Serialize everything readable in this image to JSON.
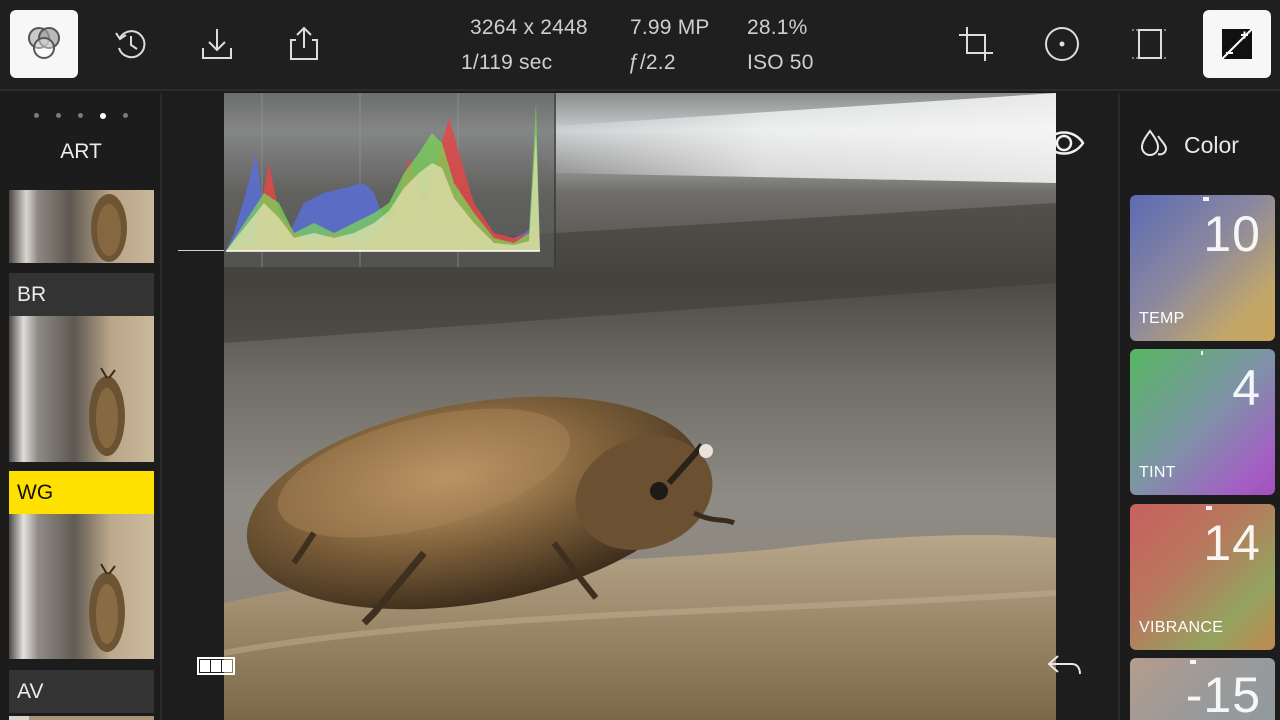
{
  "toolbar": {
    "left_icons": [
      "color-circles-icon",
      "history-icon",
      "download-icon",
      "share-icon"
    ],
    "right_icons": [
      "crop-icon",
      "vignette-icon",
      "frame-icon",
      "compare-icon"
    ]
  },
  "photo_info": {
    "resolution": "3264 x 2448",
    "megapixels": "7.99 MP",
    "zoom": "28.1%",
    "shutter": "1/119 sec",
    "aperture": "ƒ/2.2",
    "iso": "ISO 50"
  },
  "filters": {
    "page_count": 5,
    "active_page": 4,
    "title": "ART",
    "items": [
      {
        "label": "BR",
        "selected": false
      },
      {
        "label": "WG",
        "selected": true
      },
      {
        "label": "AV",
        "selected": false
      }
    ]
  },
  "adjustments": {
    "title": "Color",
    "items": [
      {
        "label": "TEMP",
        "value": "10"
      },
      {
        "label": "TINT",
        "value": "4"
      },
      {
        "label": "VIBRANCE",
        "value": "14"
      },
      {
        "label": "",
        "value": "-15"
      }
    ]
  },
  "colors": {
    "selected_filter": "#ffe100",
    "toolbar_bg": "#1f1f1f",
    "panel_bg": "#1c1c1c"
  }
}
